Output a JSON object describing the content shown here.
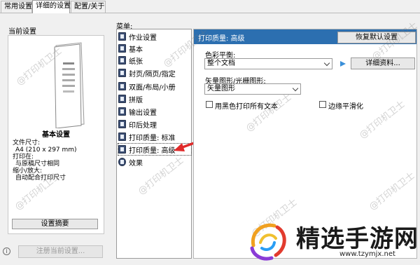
{
  "tabs": [
    "常用设置",
    "详细的设置",
    "配置/关于"
  ],
  "left": {
    "current_settings_label": "当前设置",
    "summary_title": "基本设置",
    "file_size_label": "文件尺寸:",
    "file_size_value": "A4 (210 x 297 mm)",
    "print_on_label": "打印在:",
    "print_on_value": "与原稿尺寸相同",
    "zoom_label": "缩小/放大:",
    "zoom_value": "自动配合打印尺寸",
    "preview_button": "设置摘要",
    "register_button": "注册当前设置..."
  },
  "menu": {
    "label": "菜单:",
    "items": [
      "作业设置",
      "基本",
      "纸张",
      "封页/隔页/指定",
      "双面/布局/小册",
      "拼版",
      "输出设置",
      "印后处理",
      "打印质量: 标准",
      "打印质量: 高级",
      "效果"
    ]
  },
  "panel": {
    "title": "打印质量: 高级",
    "restore_button": "恢复默认设置",
    "color_balance_label": "色彩平衡:",
    "color_balance_value": "整个文档",
    "details_button": "详细资料...",
    "vector_label": "矢量图形/光栅图形:",
    "vector_value": "矢量图形",
    "black_text_label": "用黑色打印所有文本",
    "edge_smooth_label": "边缘平滑化"
  },
  "watermark": "@打印机卫士",
  "brand": {
    "name": "精选手游网",
    "url": "www.tzymjx.net"
  },
  "colors": {
    "header_blue": "#2c6fb0",
    "arrow_red": "#e02a2a",
    "play_blue": "#3a8fd9"
  }
}
